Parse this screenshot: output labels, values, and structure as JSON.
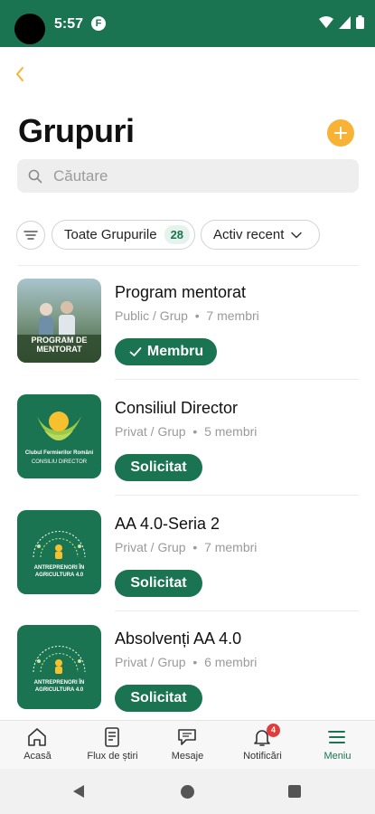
{
  "status_bar": {
    "time": "5:57",
    "app_icon": "F"
  },
  "header": {
    "title": "Grupuri",
    "back_icon": "chevron-left-icon",
    "add_icon": "plus-icon"
  },
  "search": {
    "placeholder": "Căutare"
  },
  "filters": {
    "all_label": "Toate Grupurile",
    "all_count": "28",
    "sort_label": "Activ recent"
  },
  "groups": [
    {
      "name": "Program mentorat",
      "meta": "Public / Grup",
      "members": "7 membri",
      "action": "Membru",
      "thumb_text": "PROGRAM DE MENTORAT"
    },
    {
      "name": "Consiliul Director",
      "meta": "Privat / Grup",
      "members": "5 membri",
      "action": "Solicitat",
      "thumb_text": "Clubul Fermierilor Români",
      "thumb_sub": "CONSILIU DIRECTOR"
    },
    {
      "name": "AA 4.0-Seria 2",
      "meta": "Privat / Grup",
      "members": "7 membri",
      "action": "Solicitat",
      "thumb_text": "ANTREPRENORI ÎN AGRICULTURA 4.0"
    },
    {
      "name": "Absolvenți AA 4.0",
      "meta": "Privat / Grup",
      "members": "6 membri",
      "action": "Solicitat",
      "thumb_text": "ANTREPRENORI ÎN AGRICULTURA 4.0"
    }
  ],
  "bottom_nav": [
    {
      "label": "Acasă",
      "icon": "home-icon"
    },
    {
      "label": "Flux de știri",
      "icon": "news-feed-icon"
    },
    {
      "label": "Mesaje",
      "icon": "messages-icon"
    },
    {
      "label": "Notificări",
      "icon": "bell-icon",
      "badge": "4"
    },
    {
      "label": "Meniu",
      "icon": "menu-icon",
      "active": true
    }
  ],
  "colors": {
    "brand": "#1a7351",
    "accent": "#f6b335",
    "badge": "#e13c3c"
  }
}
